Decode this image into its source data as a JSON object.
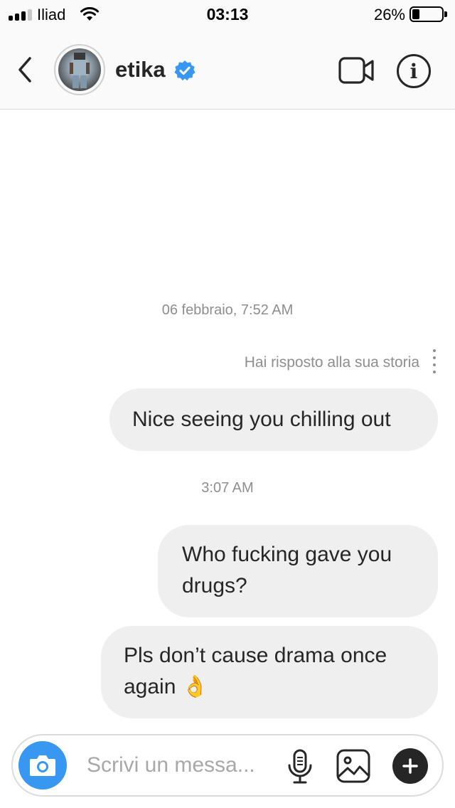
{
  "status_bar": {
    "carrier": "Iliad",
    "time": "03:13",
    "battery_percent": "26%",
    "battery_level": 0.26
  },
  "header": {
    "back_icon": "chevron-left-icon",
    "username": "etika",
    "verified_icon": "verified-badge-icon",
    "video_icon": "video-camera-icon",
    "info_icon": "info-icon",
    "info_glyph": "i"
  },
  "conversation": {
    "timestamp_1": "06 febbraio, 7:52 AM",
    "reply_note": "Hai risposto alla sua storia",
    "messages": [
      {
        "text": "Nice seeing you chilling out"
      },
      {
        "text": "Who fucking gave you drugs?"
      },
      {
        "text": "Pls don’t cause drama once again 👌"
      }
    ],
    "timestamp_2": "3:07 AM"
  },
  "composer": {
    "placeholder": "Scrivi un messa...",
    "camera_icon": "camera-icon",
    "mic_icon": "microphone-icon",
    "gallery_icon": "image-gallery-icon",
    "plus_icon": "plus-icon"
  },
  "colors": {
    "accent_blue": "#3897f0",
    "bubble_bg": "#efefef",
    "text_dark": "#262626",
    "text_muted": "#8e8e8e"
  }
}
